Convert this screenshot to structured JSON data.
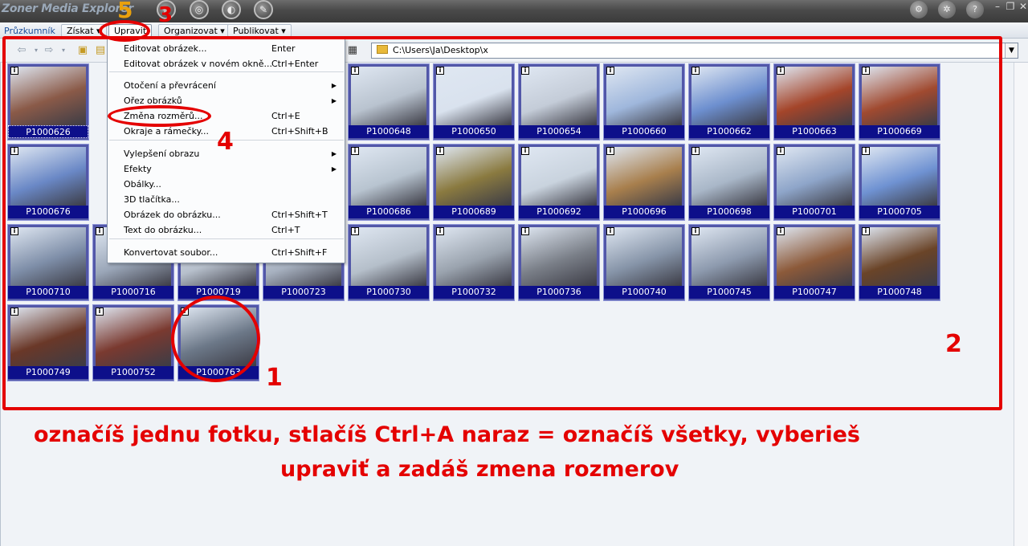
{
  "app": {
    "title": "Zoner Media Explorer",
    "version": "5"
  },
  "menubar": {
    "explorer": "Průzkumník",
    "items": [
      {
        "label": "Získat ▾"
      },
      {
        "label": "Upravit"
      },
      {
        "label": "Organizovat ▾"
      },
      {
        "label": "Publikovat ▾"
      }
    ]
  },
  "address": {
    "path": "C:\\Users\\Ja\\Desktop\\x"
  },
  "edit_menu": {
    "items": [
      {
        "label": "Editovat obrázek...",
        "shortcut": "Enter"
      },
      {
        "label": "Editovat obrázek v novém okně...",
        "shortcut": "Ctrl+Enter"
      },
      {
        "label": "Otočení a převrácení",
        "shortcut": ""
      },
      {
        "label": "Ořez obrázků",
        "shortcut": ""
      },
      {
        "label": "Změna rozměrů...",
        "shortcut": "Ctrl+E"
      },
      {
        "label": "Okraje a rámečky...",
        "shortcut": "Ctrl+Shift+B"
      },
      {
        "label": "Vylepšení obrazu",
        "shortcut": ""
      },
      {
        "label": "Efekty",
        "shortcut": ""
      },
      {
        "label": "Obálky...",
        "shortcut": ""
      },
      {
        "label": "3D tlačítka...",
        "shortcut": ""
      },
      {
        "label": "Obrázek do obrázku...",
        "shortcut": "Ctrl+Shift+T"
      },
      {
        "label": "Text do obrázku...",
        "shortcut": "Ctrl+T"
      },
      {
        "label": "Konvertovat soubor...",
        "shortcut": "Ctrl+Shift+F"
      }
    ]
  },
  "thumbnails": [
    {
      "name": "P1000626",
      "color": "#8a5a48"
    },
    {
      "name": "P1000648",
      "color": "#b9c3cf"
    },
    {
      "name": "P1000650",
      "color": "#d9e2ee"
    },
    {
      "name": "P1000654",
      "color": "#c4ccd8"
    },
    {
      "name": "P1000660",
      "color": "#9fb7dc"
    },
    {
      "name": "P1000662",
      "color": "#6d8fcf"
    },
    {
      "name": "P1000663",
      "color": "#a4452a"
    },
    {
      "name": "P1000669",
      "color": "#a04a30"
    },
    {
      "name": "P1000676",
      "color": "#6a88c6"
    },
    {
      "name": "P1000686",
      "color": "#b8c4d0"
    },
    {
      "name": "P1000689",
      "color": "#8a7a40"
    },
    {
      "name": "P1000692",
      "color": "#c9d3de"
    },
    {
      "name": "P1000696",
      "color": "#a87f4d"
    },
    {
      "name": "P1000698",
      "color": "#a9b7c8"
    },
    {
      "name": "P1000701",
      "color": "#8ea5c9"
    },
    {
      "name": "P1000705",
      "color": "#6f92d2"
    },
    {
      "name": "P1000710",
      "color": "#7e8ea8"
    },
    {
      "name": "P1000716",
      "color": "#9aa6b8"
    },
    {
      "name": "P1000719",
      "color": "#b7c0cc"
    },
    {
      "name": "P1000723",
      "color": "#a7b1c0"
    },
    {
      "name": "P1000730",
      "color": "#b5bfca"
    },
    {
      "name": "P1000732",
      "color": "#9aa3ae"
    },
    {
      "name": "P1000736",
      "color": "#7a7f88"
    },
    {
      "name": "P1000740",
      "color": "#8694a8"
    },
    {
      "name": "P1000745",
      "color": "#8d9aae"
    },
    {
      "name": "P1000747",
      "color": "#8c5a3a"
    },
    {
      "name": "P1000748",
      "color": "#6a4428"
    },
    {
      "name": "P1000749",
      "color": "#6a3828"
    },
    {
      "name": "P1000752",
      "color": "#7a3a30"
    },
    {
      "name": "P1000763",
      "color": "#6c7888"
    }
  ],
  "annotations": {
    "n1": "1",
    "n2": "2",
    "n3": "3",
    "n4": "4",
    "caption_line1": "označíš jednu fotku, stlačíš Ctrl+A naraz = označíš všetky, vyberieš",
    "caption_line2": "upraviť a zadáš zmena rozmerov"
  }
}
